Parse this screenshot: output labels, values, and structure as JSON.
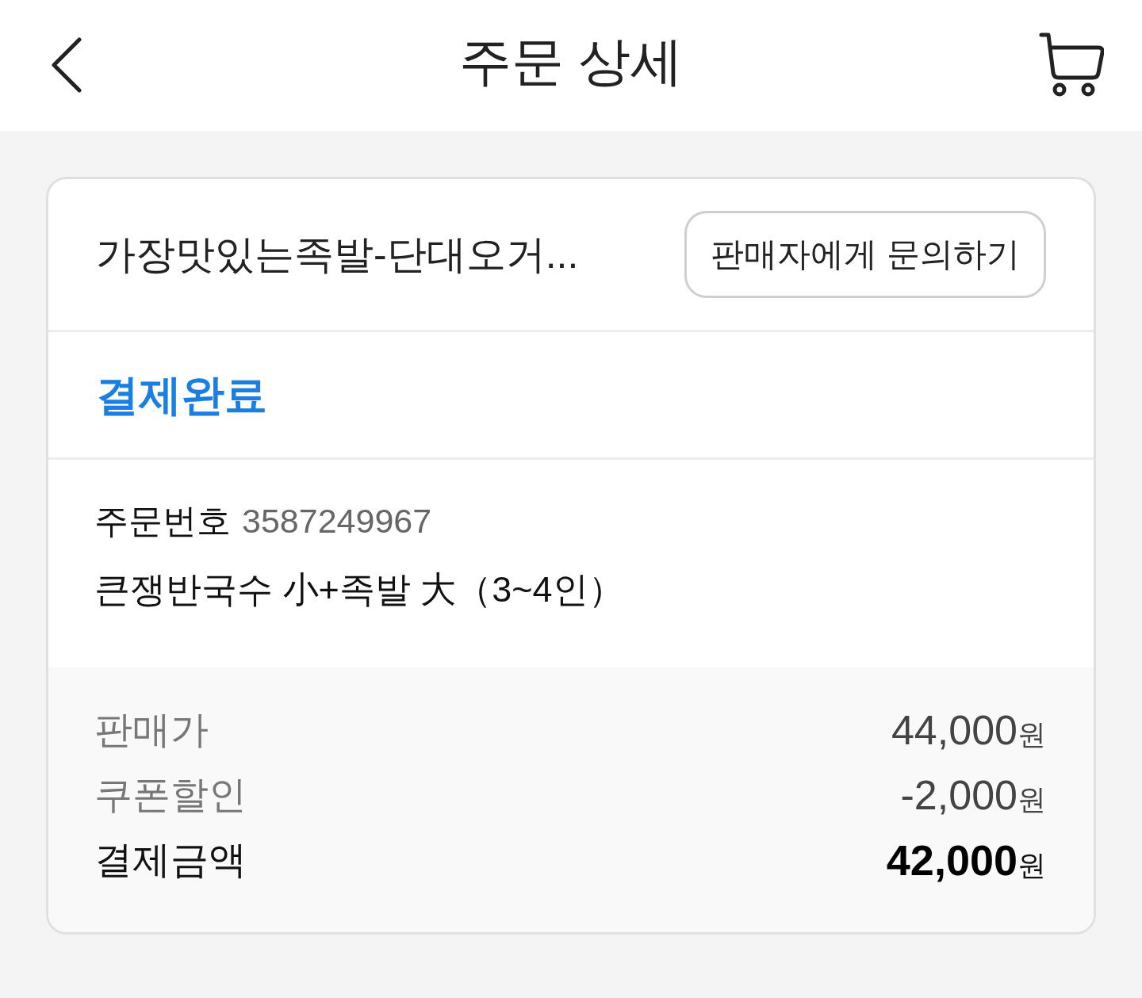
{
  "header": {
    "title": "주문 상세"
  },
  "order": {
    "store_name": "가장맛있는족발-단대오거...",
    "inquiry_button": "판매자에게 문의하기",
    "status": "결제완료",
    "order_number_label": "주문번호",
    "order_number": "3587249967",
    "item": "큰쟁반국수 小+족발 大（3~4인）"
  },
  "price_rows": [
    {
      "kind": "line",
      "label": "판매가",
      "amount": "44,000",
      "unit": "원"
    },
    {
      "kind": "line",
      "label": "쿠폰할인",
      "amount": "-2,000",
      "unit": "원"
    },
    {
      "kind": "total",
      "label": "결제금액",
      "amount": "42,000",
      "unit": "원"
    }
  ]
}
